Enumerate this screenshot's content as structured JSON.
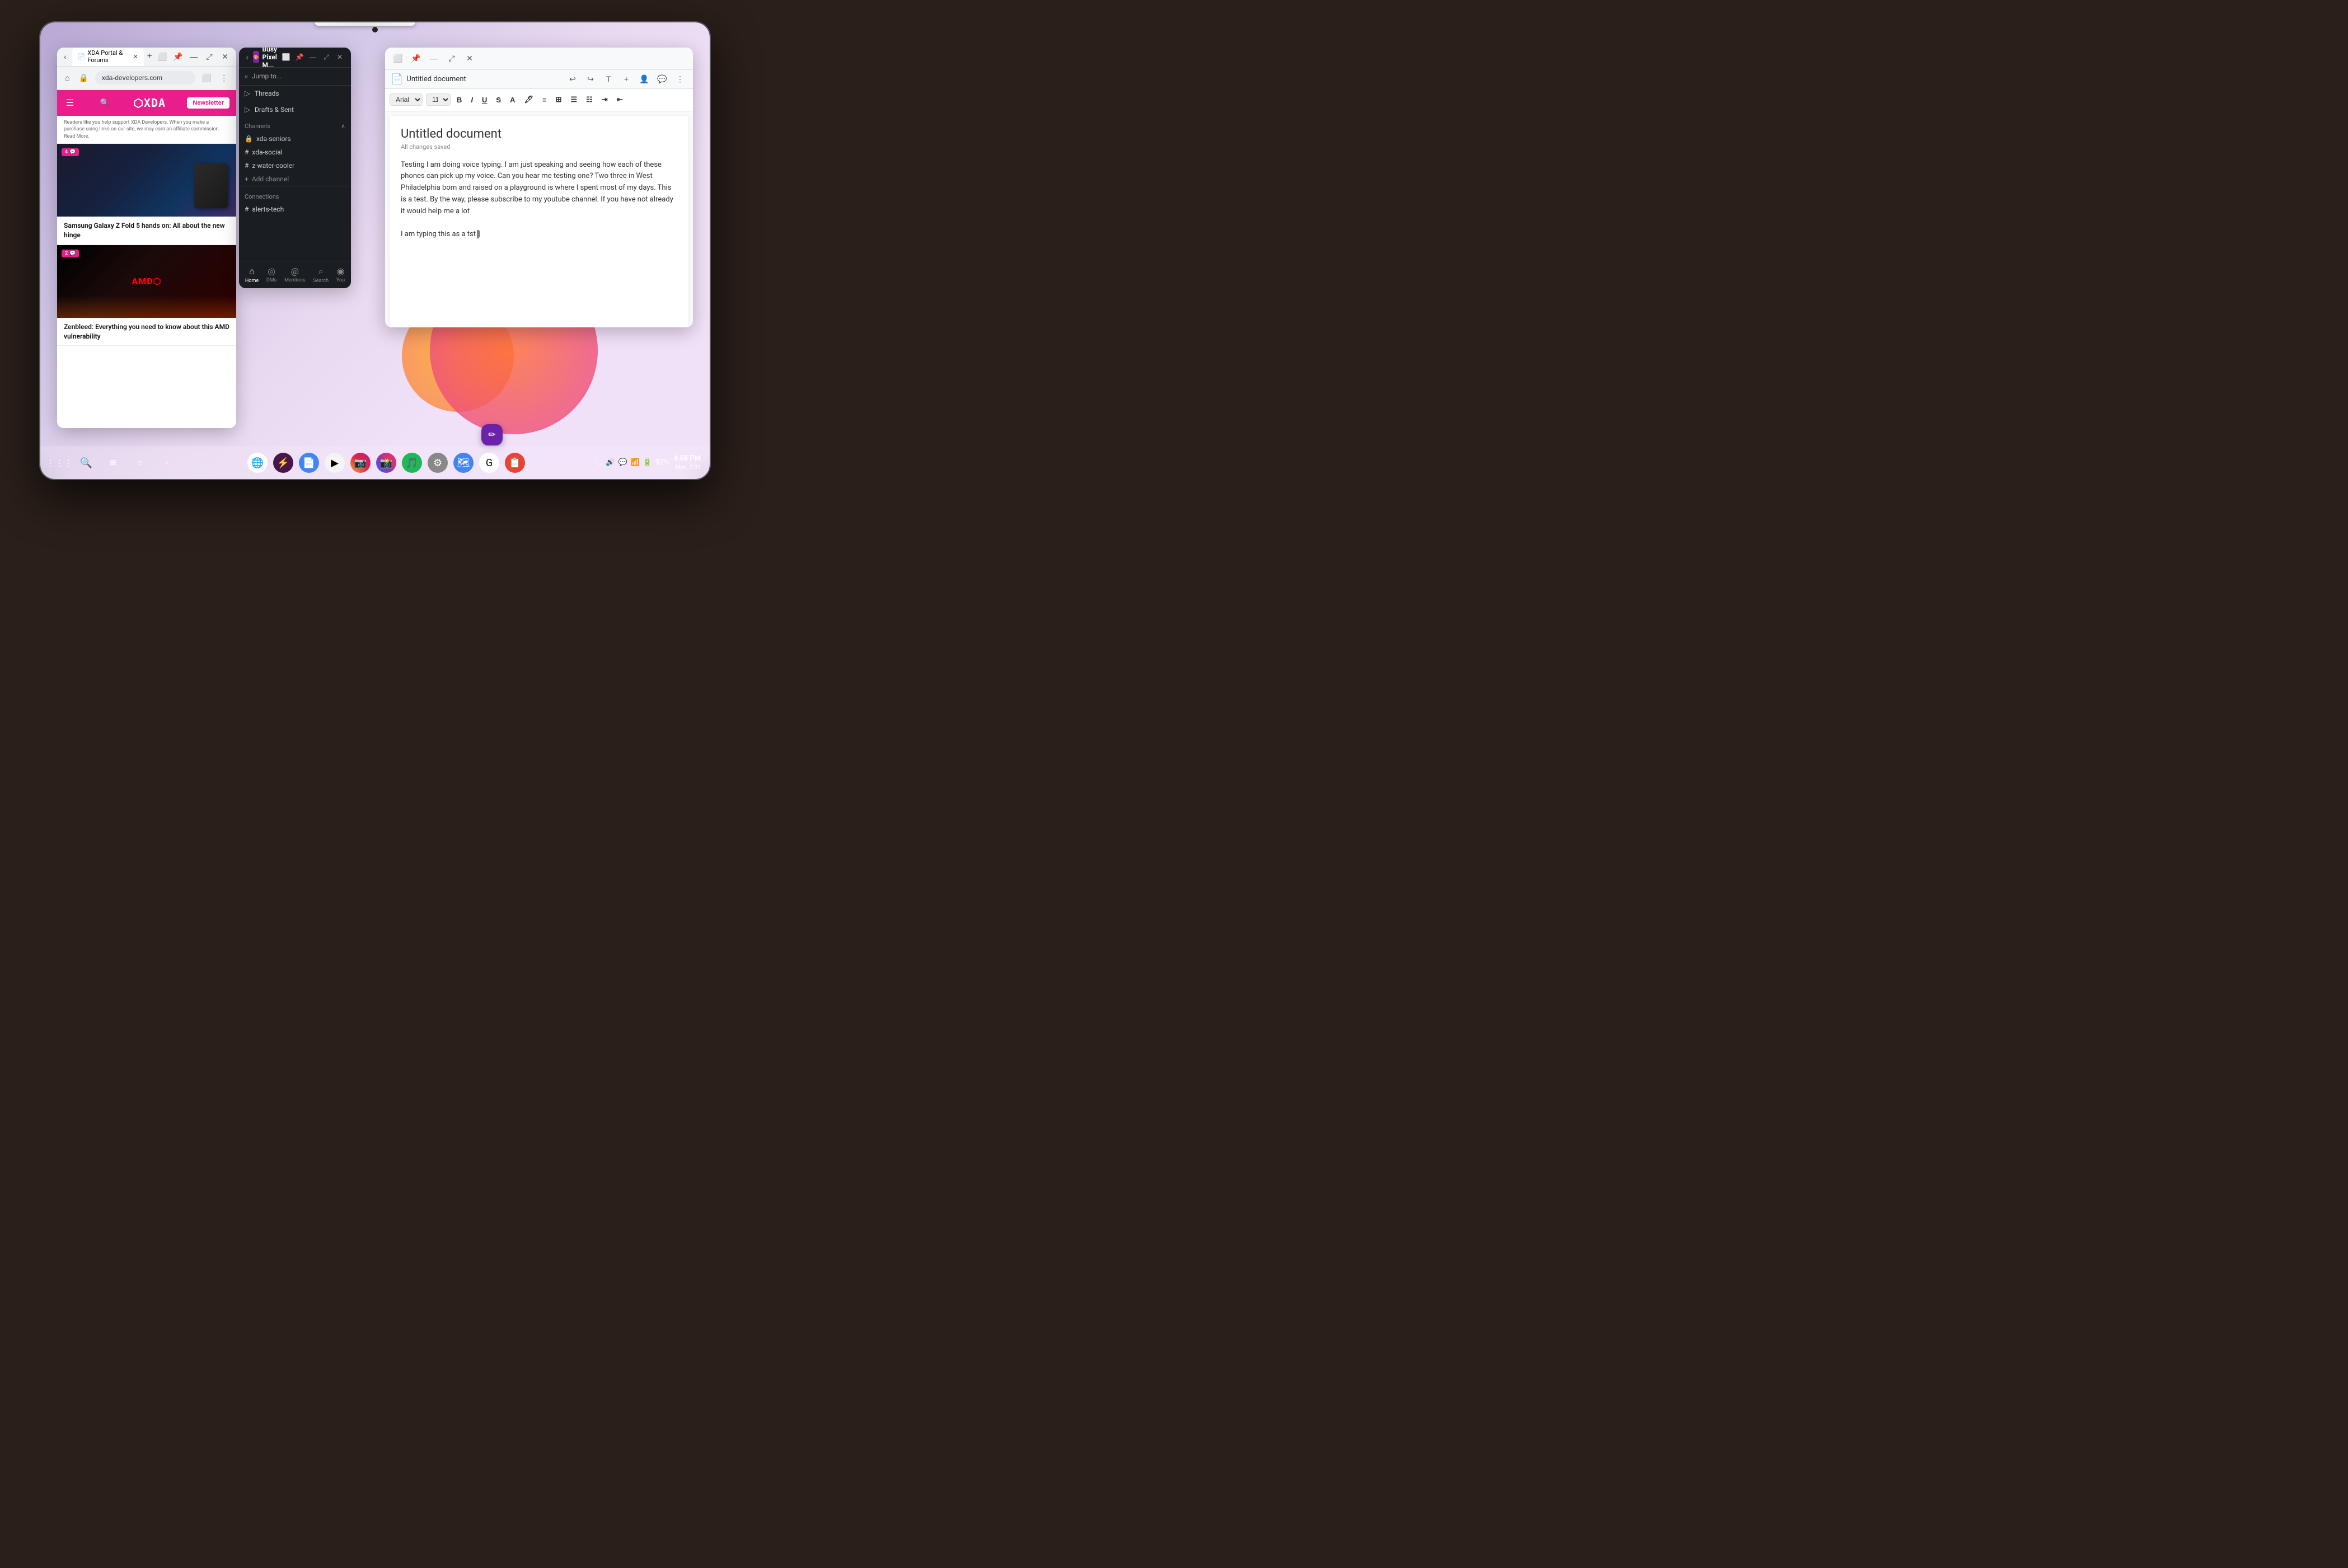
{
  "tablet": {
    "pencil": "Apple Pencil"
  },
  "browser": {
    "tab_title": "XDA Portal & Forums",
    "url": "xda-developers.com",
    "logo": "⬡XDA",
    "newsletter_btn": "Newsletter",
    "tagline": "Readers like you help support XDA Developers. When you make a purchase using links on our site, we may earn an affiliate commission. Read More.",
    "article1": {
      "badge": "4",
      "title": "Samsung Galaxy Z Fold 5 hands on: All about the new hinge"
    },
    "article2": {
      "badge": "2",
      "title": "Zenbleed: Everything you need to know about this AMD vulnerability"
    }
  },
  "slack": {
    "workspace_name": "Busy Pixel M...",
    "jump_to": "Jump to...",
    "threads": "Threads",
    "drafts": "Drafts & Sent",
    "channels_label": "Channels",
    "channels": [
      {
        "name": "xda-seniors",
        "lock": true
      },
      {
        "name": "xda-social",
        "lock": false
      },
      {
        "name": "z-water-cooler",
        "lock": false
      }
    ],
    "add_channel": "Add channel",
    "connections_label": "Connections",
    "connection_channel": "alerts-tech",
    "bottom_nav": [
      {
        "label": "Home",
        "icon": "⌂",
        "active": true
      },
      {
        "label": "DMs",
        "icon": "◎"
      },
      {
        "label": "Mentions",
        "icon": "@"
      },
      {
        "label": "Search",
        "icon": "⌕"
      },
      {
        "label": "You",
        "icon": "◉"
      }
    ]
  },
  "docs": {
    "title": "Untitled document",
    "saved_status": "All changes saved",
    "font": "Arial",
    "font_size": "11",
    "toolbar_buttons": [
      "B",
      "I",
      "U",
      "S",
      "A",
      "🖊"
    ],
    "body_text": "Testing I am doing voice typing. I am just speaking and seeing how each of these phones can pick up my voice. Can you hear me testing one? Two three in West Philadelphia born and raised on a playground is where I spent most of my days. This is a test. By the way, please subscribe to my youtube channel. If you have not already it would help me a lot\n\nI am typing this as a tst |"
  },
  "taskbar": {
    "time": "4:58 PM",
    "date": "Mon, 7/31",
    "battery": "92%"
  }
}
